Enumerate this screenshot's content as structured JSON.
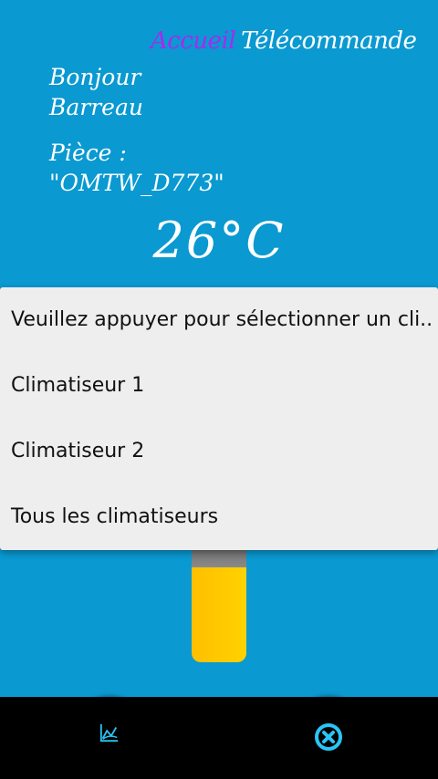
{
  "header": {
    "tab_accueil": "Accueil",
    "tab_telecommande": "Télécommande"
  },
  "greeting": {
    "line1": "Bonjour",
    "line2": "Barreau"
  },
  "room": {
    "label": "Pièce :",
    "value": "\"OMTW_D773\""
  },
  "temperature": {
    "value": "26°C"
  },
  "dropdown": {
    "items": [
      {
        "label": "Veuillez appuyer pour sélectionner un cli.."
      },
      {
        "label": "Climatiseur 1"
      },
      {
        "label": "Climatiseur 2"
      },
      {
        "label": "Tous les climatiseurs"
      }
    ]
  },
  "icons": {
    "left": "chart-icon",
    "right": "close-circle-icon"
  },
  "colors": {
    "background": "#0a99d1",
    "accent_purple": "#a42bf0",
    "icon_cyan": "#29c5f6",
    "thermo_fill": "#ffc800"
  }
}
